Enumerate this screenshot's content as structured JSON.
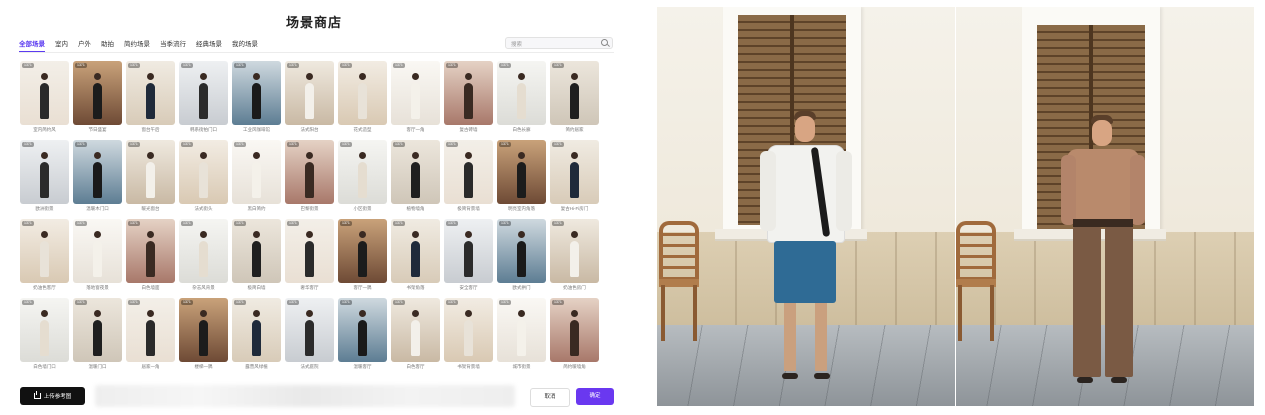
{
  "store": {
    "title": "场景商店",
    "tabs": [
      "全部场景",
      "室内",
      "户外",
      "助拍",
      "简约场景",
      "当季流行",
      "经典场景",
      "我的场景"
    ],
    "active_tab": "全部场景",
    "search_placeholder": "搜索",
    "badge_text": "1371",
    "rows": [
      [
        "室内简约风",
        "节日盛宴",
        "窗台午后",
        "韩系街拍门口",
        "工业风咖啡馆",
        "法式阳台",
        "花式造型",
        "客厅一角",
        "复古砖墙",
        "白色长廊",
        "简约居家"
      ],
      [
        "欧洲街景",
        "温暖木门口",
        "暖光窗台",
        "法式街头",
        "黑白简约",
        "巴黎街景",
        "小区街景",
        "植物墙角",
        "极简背景墙",
        "明亮室内角落",
        "复古Hi-Fi房门"
      ],
      [
        "奶油色客厅",
        "落地窗夜景",
        "白色墙面",
        "杂志风背景",
        "极简白墙",
        "奢华客厅",
        "客厅一隅",
        "书架角落",
        "安全客厅",
        "欧式拱门",
        "奶油色房门"
      ],
      [
        "白色墙门口",
        "温暖门口",
        "居家一角",
        "楼梯一隅",
        "露营风绿植",
        "法式庭院",
        "温暖客厅",
        "白色客厅",
        "书架背景墙",
        "城市街景",
        "简约暖墙角"
      ]
    ],
    "upload_label": "上传参考图",
    "cancel_label": "取消",
    "confirm_label": "确定"
  },
  "colors": {
    "accent": "#5b3bf0",
    "confirm": "#6a38f0"
  }
}
